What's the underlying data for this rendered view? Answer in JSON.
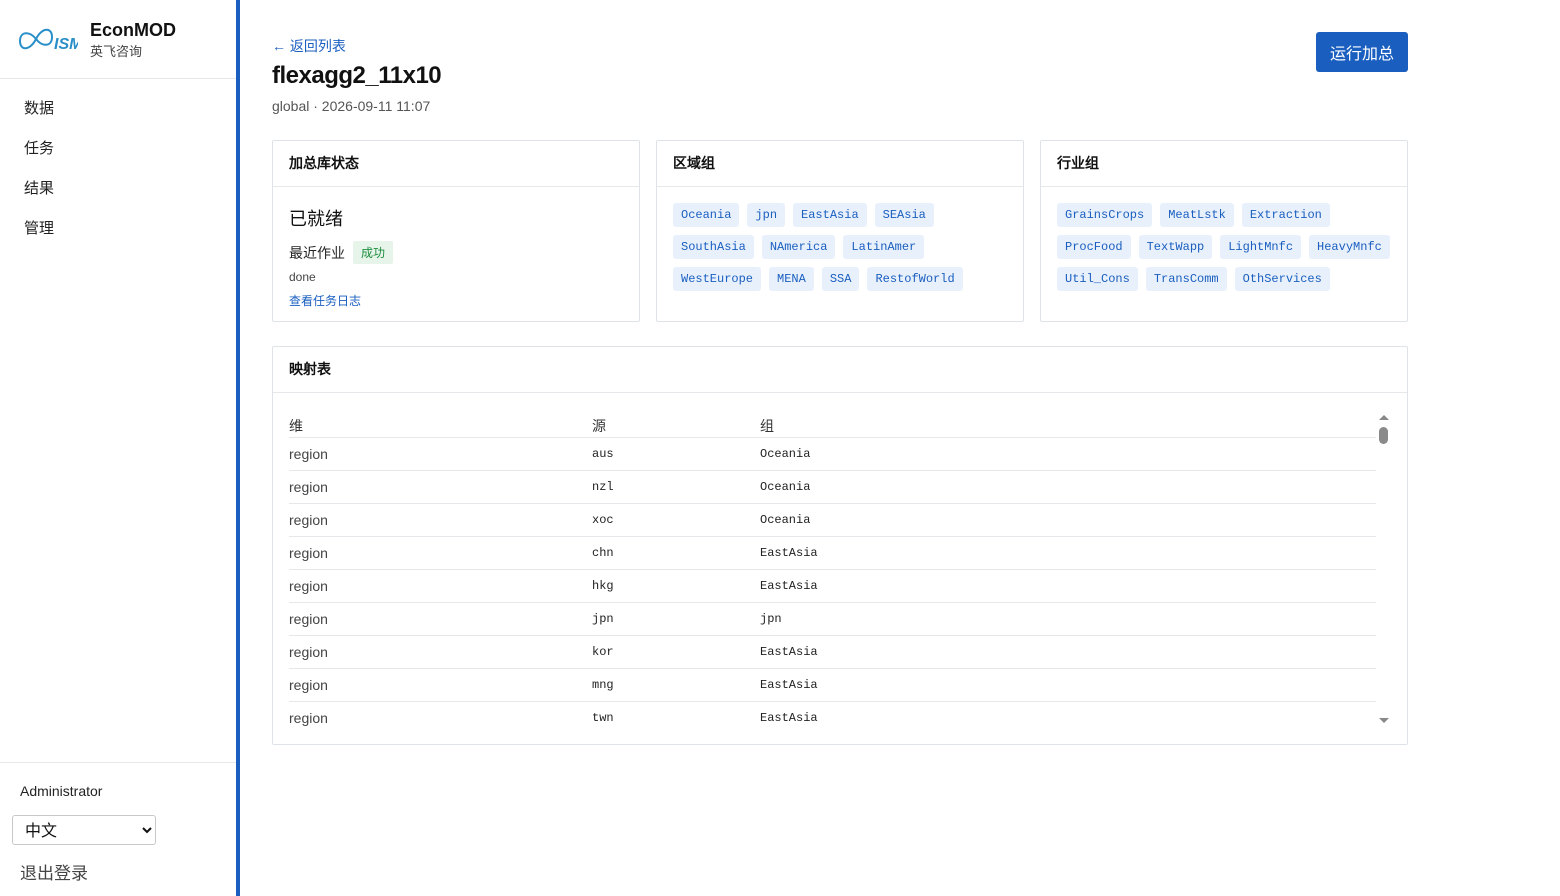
{
  "brand": {
    "name": "EconMOD",
    "subtitle": "英飞咨询"
  },
  "sidebar": {
    "items": [
      {
        "label": "数据"
      },
      {
        "label": "任务"
      },
      {
        "label": "结果"
      },
      {
        "label": "管理"
      }
    ],
    "user": "Administrator",
    "language": {
      "selected": "中文"
    },
    "logout": "退出登录"
  },
  "header": {
    "back": "← 返回列表",
    "title": "flexagg2_11x10",
    "subtitle": "global · 2026-09-11 11:07",
    "run_button": "运行加总"
  },
  "status_card": {
    "title": "加总库状态",
    "status": "已就绪",
    "job_label": "最近作业",
    "job_badge": "成功",
    "job_state": "done",
    "log_link": "查看任务日志"
  },
  "region_card": {
    "title": "区域组",
    "groups": [
      "Oceania",
      "jpn",
      "EastAsia",
      "SEAsia",
      "SouthAsia",
      "NAmerica",
      "LatinAmer",
      "WestEurope",
      "MENA",
      "SSA",
      "RestofWorld"
    ]
  },
  "sector_card": {
    "title": "行业组",
    "groups": [
      "GrainsCrops",
      "MeatLstk",
      "Extraction",
      "ProcFood",
      "TextWapp",
      "LightMnfc",
      "HeavyMnfc",
      "Util_Cons",
      "TransComm",
      "OthServices"
    ]
  },
  "mapping": {
    "title": "映射表",
    "columns": [
      "维",
      "源",
      "组"
    ],
    "rows": [
      [
        "region",
        "aus",
        "Oceania"
      ],
      [
        "region",
        "nzl",
        "Oceania"
      ],
      [
        "region",
        "xoc",
        "Oceania"
      ],
      [
        "region",
        "chn",
        "EastAsia"
      ],
      [
        "region",
        "hkg",
        "EastAsia"
      ],
      [
        "region",
        "jpn",
        "jpn"
      ],
      [
        "region",
        "kor",
        "EastAsia"
      ],
      [
        "region",
        "mng",
        "EastAsia"
      ],
      [
        "region",
        "twn",
        "EastAsia"
      ]
    ]
  },
  "colors": {
    "accent": "#1a5fc0",
    "success": "#1e8e3e",
    "chip_bg": "#e8f0fb"
  },
  "icons": {
    "logo": "ism-infinity-logo",
    "back": "arrow-left-icon"
  }
}
